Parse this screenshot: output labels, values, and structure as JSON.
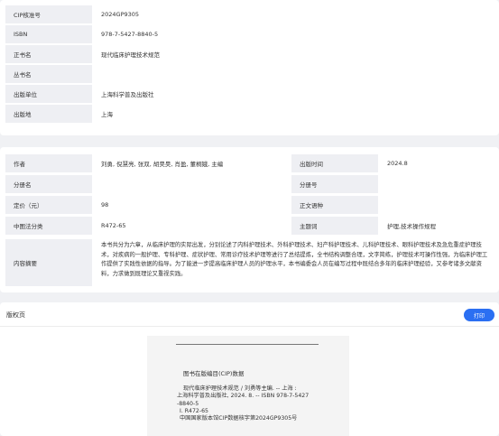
{
  "basic": {
    "rows": [
      {
        "label": "CIP核准号",
        "value": "2024GP9305"
      },
      {
        "label": "ISBN",
        "value": "978-7-5427-8840-5"
      },
      {
        "label": "正书名",
        "value": "现代临床护理技术规范"
      },
      {
        "label": "丛书名",
        "value": ""
      },
      {
        "label": "出版单位",
        "value": "上海科学普及出版社"
      },
      {
        "label": "出版地",
        "value": "上海"
      }
    ]
  },
  "details": {
    "author_label": "作者",
    "author": "刘勇, 倪慧亮, 张双, 胡昊昊, 肖盈, 董桐娥, 主编",
    "pubtime_label": "出版时间",
    "pubtime": "2024.8",
    "part_label": "分册名",
    "part": "",
    "partno_label": "分册号",
    "partno": "",
    "price_label": "定价（元）",
    "price": "98",
    "lang_label": "正文语种",
    "lang": "",
    "clc_label": "中图法分类",
    "clc": "R472-65",
    "subject_label": "主题词",
    "subject": "护理,技术操作规程",
    "abstract_label": "内容摘要",
    "abstract": "本书共分为六章，从临床护理的实际出发，分别论述了内科护理技术、外科护理技术、妇产科护理技术、儿科护理技术、眼科护理技术及急危重症护理技术，对疾病的一般护理、专科护理、症状护理、常用诊疗技术护理等进行了总结提炼，全书结构调整合理，文字简练，护理技术可操作性强，为临床护理工作提供了实践性依据的指导。为了能进一步提高临床护理人员的护理水平，本书编委会人员在编写过程中既结合多年的临床护理经验，又参考诸多文献资料，力求做到既理论又重视实践。"
  },
  "copyright": {
    "title": "版权页",
    "print_button": "打印",
    "cip_title": "图书在版编目(CIP)数据",
    "cip_lines": [
      "现代临床护理技术规范 / 刘勇等主编. -- 上海 :",
      "上海科学普及出版社, 2024. 8. -- ISBN 978-7-5427",
      "-8840-5",
      "Ⅰ. R472-65",
      "中国国家版本馆CIP数据核字第2024GP9305号"
    ]
  }
}
